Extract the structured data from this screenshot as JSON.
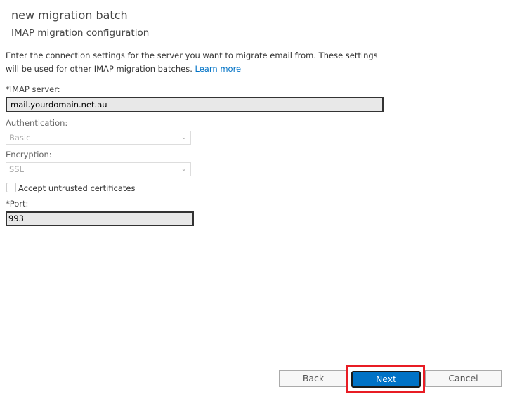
{
  "header": {
    "title": "new migration batch",
    "subtitle": "IMAP migration configuration"
  },
  "description": {
    "text": "Enter the connection settings for the server you want to migrate email from. These settings will be used for other IMAP migration batches. ",
    "link": "Learn more"
  },
  "form": {
    "imap_server": {
      "label": "*IMAP server:",
      "value": "mail.yourdomain.net.au"
    },
    "authentication": {
      "label": "Authentication:",
      "value": "Basic"
    },
    "encryption": {
      "label": "Encryption:",
      "value": "SSL"
    },
    "accept_untrusted": {
      "label": "Accept untrusted certificates",
      "checked": false
    },
    "port": {
      "label": "*Port:",
      "value": "993"
    }
  },
  "buttons": {
    "back": "Back",
    "next": "Next",
    "cancel": "Cancel"
  },
  "colors": {
    "accent": "#0072c6",
    "highlight": "#e81c24"
  }
}
